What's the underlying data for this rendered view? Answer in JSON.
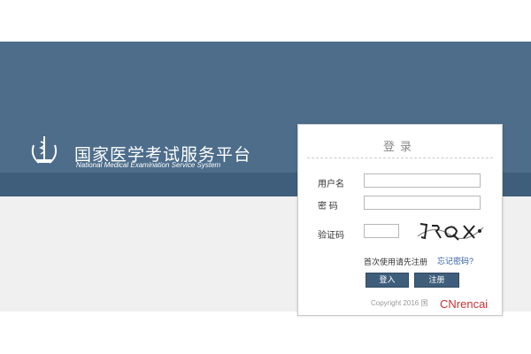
{
  "site": {
    "title": "国家医学考试服务平台",
    "subtitle": "National Medical Examination Service System",
    "logo_icon": "medical-emblem-icon"
  },
  "login": {
    "title": "登录",
    "username_label": "用户名",
    "username_value": "",
    "password_label": "密 码",
    "password_value": "",
    "captcha_label": "验证码",
    "captcha_value": "",
    "captcha_text": "JRQX",
    "register_hint": "首次使用请先注册",
    "forgot_password": "忘记密码?",
    "login_button": "登入",
    "register_button": "注册",
    "copyright": "Copyright 2016 国",
    "watermark": "CNrencai"
  },
  "colors": {
    "banner": "#4d6d8b",
    "banner_dark": "#3f5e7b",
    "link": "#2e5d9a",
    "button": "#3f5e7b"
  }
}
